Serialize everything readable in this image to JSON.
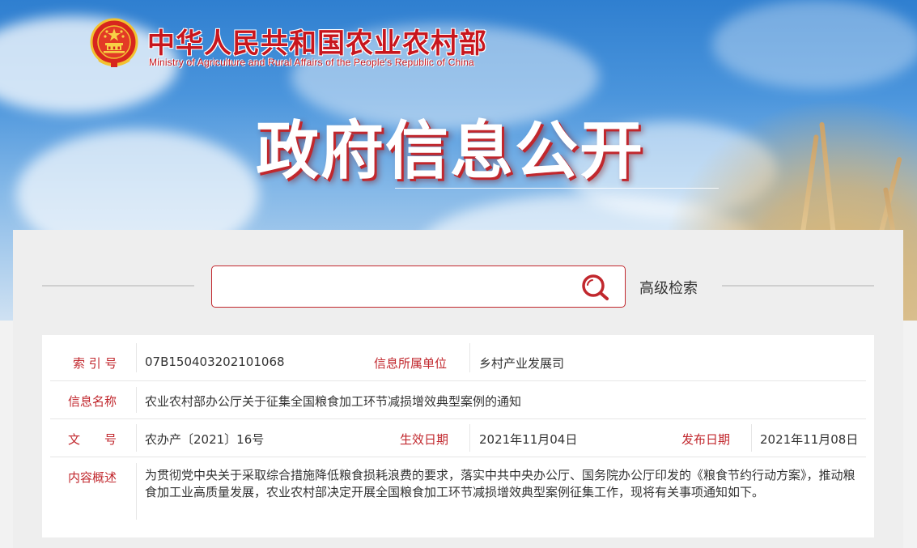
{
  "header": {
    "ministry_cn": "中华人民共和国农业农村部",
    "ministry_en": "Ministry of Agriculture and Rural Affairs of the People's Republic of China",
    "banner_title": "政府信息公开"
  },
  "search": {
    "value": "",
    "placeholder": "",
    "advanced_label": "高级检索",
    "icon": "search-icon"
  },
  "info": {
    "index_label": "索 引 号",
    "index_value": "07B150403202101068",
    "unit_label": "信息所属单位",
    "unit_value": "乡村产业发展司",
    "name_label": "信息名称",
    "name_value": "农业农村部办公厅关于征集全国粮食加工环节减损增效典型案例的通知",
    "doc_label": "文　　号",
    "doc_value": "农办产〔2021〕16号",
    "effective_label": "生效日期",
    "effective_value": "2021年11月04日",
    "publish_label": "发布日期",
    "publish_value": "2021年11月08日",
    "summary_label": "内容概述",
    "summary_value": "为贯彻党中央关于采取综合措施降低粮食损耗浪费的要求，落实中共中央办公厅、国务院办公厅印发的《粮食节约行动方案》，推动粮食加工业高质量发展，农业农村部决定开展全国粮食加工环节减损增效典型案例征集工作，现将有关事项通知如下。"
  },
  "colors": {
    "accent_red": "#c1272d",
    "sky_blue": "#4b95dc",
    "text": "#333333"
  }
}
